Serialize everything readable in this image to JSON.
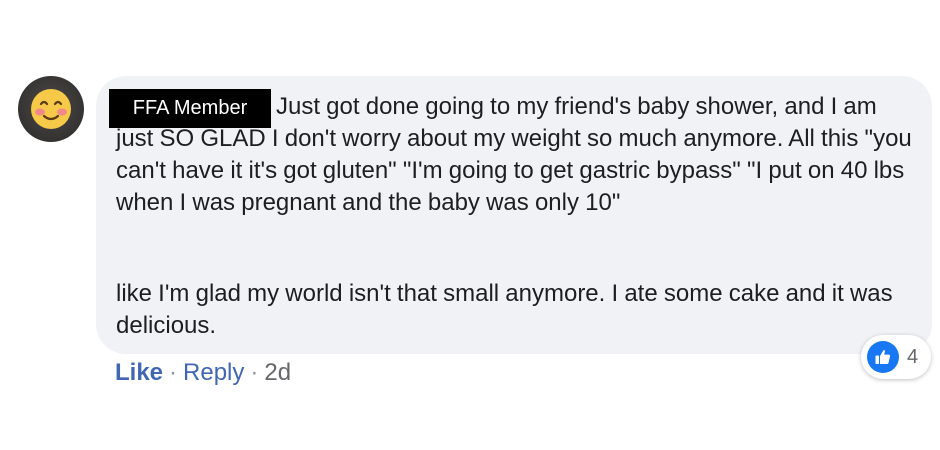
{
  "comment": {
    "author_label": "FFA Member",
    "paragraph1": "Just got done going to my friend's baby shower, and I am just SO GLAD I don't worry about my weight so much anymore. All this \"you can't have it it's got gluten\" \"I'm going to get gastric bypass\" \"I put on 40 lbs when I was pregnant and the baby was only 10\"",
    "paragraph2": "like I'm glad my world isn't that small anymore. I ate some cake and it was delicious.",
    "avatar_icon": "blushing-smiley-icon",
    "reaction_icon": "thumbs-up-icon",
    "reaction_count": "4"
  },
  "actions": {
    "like_label": "Like",
    "separator": "·",
    "reply_label": "Reply",
    "timestamp": "2d"
  },
  "colors": {
    "bubble_bg": "#f0f2f5",
    "link_blue": "#4267b2",
    "like_badge_blue": "#1877f2",
    "text_dark": "#1c1e21",
    "meta_gray": "#65676b"
  }
}
